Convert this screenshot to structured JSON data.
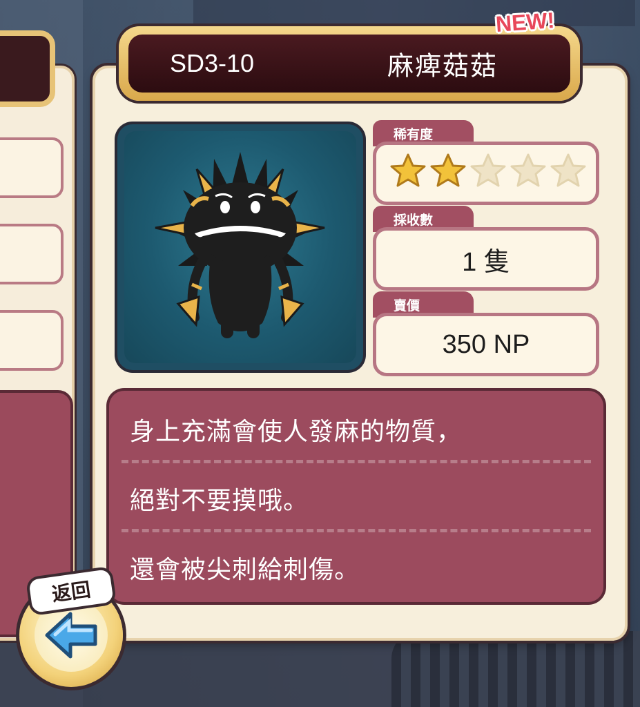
{
  "item": {
    "code": "SD3-10",
    "name": "麻痺菇菇",
    "badge": "NEW!"
  },
  "rarity": {
    "label": "稀有度",
    "filled": 2,
    "total": 5
  },
  "caught": {
    "label": "採收數",
    "value": "1 隻"
  },
  "price": {
    "label": "賣價",
    "value": "350 NP"
  },
  "description": [
    "身上充滿會使人發麻的物質，",
    "絕對不要摸哦。",
    "還會被尖刺給刺傷。"
  ],
  "back_button": {
    "label": "返回"
  },
  "colors": {
    "accent": "#9c4b5e",
    "card": "#f7efdc",
    "gold": "#e7c377",
    "star_filled": "#f2c23a",
    "star_empty": "#efe3c6"
  }
}
